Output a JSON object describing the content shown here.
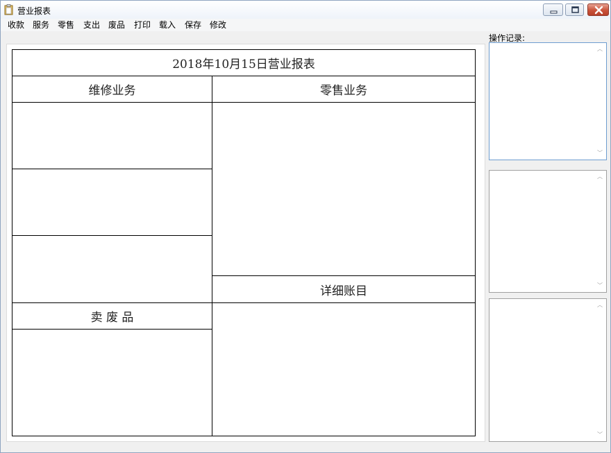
{
  "window": {
    "title": "营业报表",
    "icon": "clipboard-icon"
  },
  "menu": {
    "items": [
      {
        "label": "收款"
      },
      {
        "label": "服务"
      },
      {
        "label": "零售"
      },
      {
        "label": "支出"
      },
      {
        "label": "废品"
      },
      {
        "label": "打印"
      },
      {
        "label": "载入"
      },
      {
        "label": "保存"
      },
      {
        "label": "修改"
      }
    ]
  },
  "report": {
    "title": "2018年10月15日营业报表",
    "repair_header": "维修业务",
    "retail_header": "零售业务",
    "scrap_header": "卖 废 品",
    "detail_header": "详细账目"
  },
  "log_panel": {
    "label": "操作记录:",
    "up_arrow": "︿",
    "down_arrow": "﹀"
  },
  "colors": {
    "title_gradient_top": "#ffffff",
    "close_button": "#c9533b",
    "focus_border": "#6d9dd0",
    "window_bg": "#f0f0f0"
  }
}
